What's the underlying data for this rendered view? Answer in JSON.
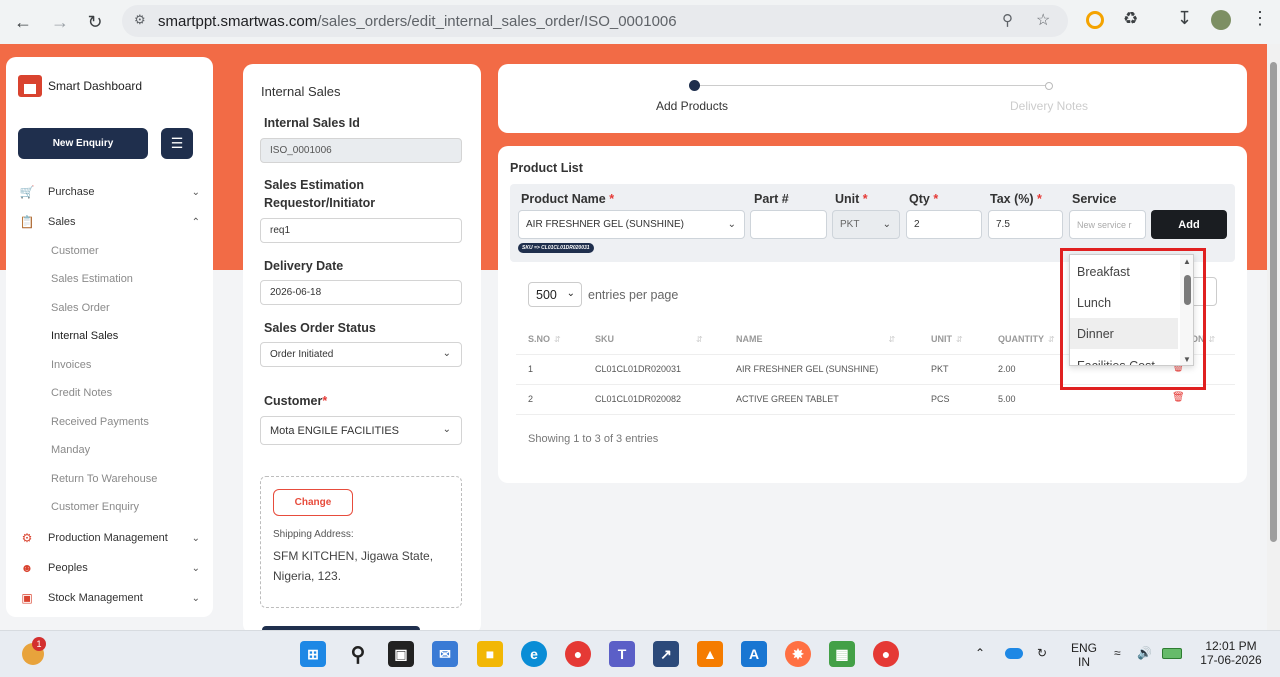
{
  "browser": {
    "url_host": "smartppt.smartwas.com",
    "url_path": "/sales_orders/edit_internal_sales_order/ISO_0001006"
  },
  "sidebar": {
    "brand": "Smart Dashboard",
    "new_enquiry": "New Enquiry",
    "items": [
      {
        "label": "Purchase"
      },
      {
        "label": "Sales"
      },
      {
        "label": "Production Management"
      },
      {
        "label": "Peoples"
      },
      {
        "label": "Stock Management"
      }
    ],
    "sales_sub": [
      "Customer",
      "Sales Estimation",
      "Sales Order",
      "Internal Sales",
      "Invoices",
      "Credit Notes",
      "Received Payments",
      "Manday",
      "Return To Warehouse",
      "Customer Enquiry"
    ]
  },
  "form": {
    "title": "Internal Sales",
    "id_label": "Internal Sales Id",
    "id_value": "ISO_0001006",
    "requestor_label": "Sales Estimation Requestor/Initiator",
    "requestor_value": "req1",
    "delivery_label": "Delivery Date",
    "delivery_value": "2026-06-18",
    "status_label": "Sales Order Status",
    "status_value": "Order Initiated",
    "customer_label": "Customer",
    "customer_req": "*",
    "customer_value": "Mota ENGILE FACILITIES",
    "change_btn": "Change",
    "shipping_label": "Shipping Address:",
    "shipping_address": "SFM KITCHEN, Jigawa State, Nigeria, 123."
  },
  "stepper": {
    "step1": "Add Products",
    "step2": "Delivery Notes"
  },
  "product_list": {
    "title": "Product List",
    "labels": {
      "product_name": "Product Name",
      "part": "Part #",
      "unit": "Unit",
      "qty": "Qty",
      "tax": "Tax (%)",
      "service": "Service",
      "req": "*"
    },
    "values": {
      "product_name": "AIR FRESHNER GEL (SUNSHINE)",
      "part": "",
      "unit": "PKT",
      "qty": "2",
      "tax": "7.5",
      "service_placeholder": "New service r"
    },
    "add_btn": "Add",
    "sku_badge": "SKU => CL01CL01DR020031",
    "entries_value": "500",
    "entries_text": "entries per page",
    "columns": [
      "S.NO",
      "SKU",
      "NAME",
      "UNIT",
      "QUANTITY",
      "ACTION"
    ],
    "rows": [
      {
        "sno": "1",
        "sku": "CL01CL01DR020031",
        "name": "AIR FRESHNER GEL (SUNSHINE)",
        "unit": "PKT",
        "qty": "2.00"
      },
      {
        "sno": "2",
        "sku": "CL01CL01DR020082",
        "name": "ACTIVE GREEN TABLET",
        "unit": "PCS",
        "qty": "5.00"
      }
    ],
    "showing": "Showing 1 to 3 of 3 entries"
  },
  "dropdown": {
    "options": [
      "Breakfast",
      "Lunch",
      "Dinner",
      "Facilities Cost"
    ],
    "hovered": "Dinner"
  },
  "taskbar": {
    "notification_count": "1",
    "lang1": "ENG",
    "lang2": "IN",
    "time": "12:01 PM",
    "date": "17-06-2026"
  },
  "colors": {
    "accent": "#f26b46",
    "navy": "#1f2f4d",
    "danger": "#e53935"
  }
}
